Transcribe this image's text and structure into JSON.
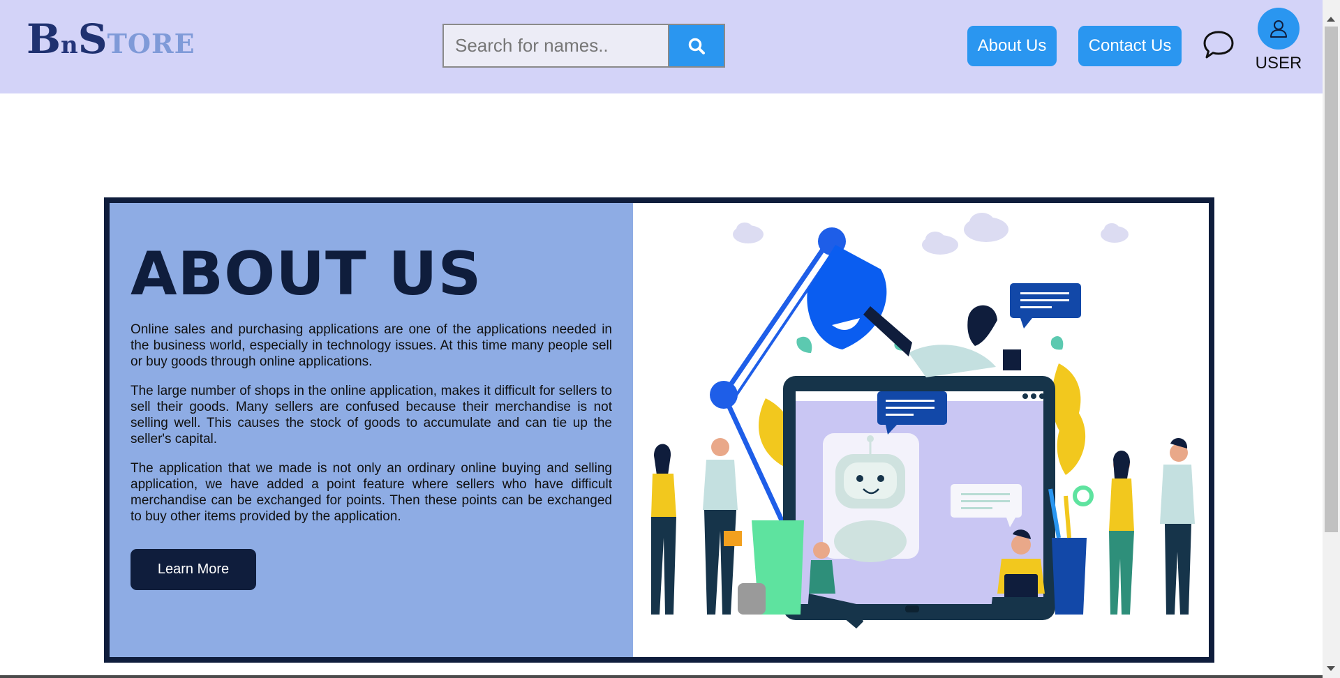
{
  "header": {
    "logo": {
      "b": "B",
      "n": "n",
      "s": "S",
      "rest": "TORE"
    },
    "search": {
      "placeholder": "Search for names..",
      "icon": "search-icon"
    },
    "nav": {
      "about_label": "About Us",
      "contact_label": "Contact Us"
    },
    "chat_icon": "chat-bubble-icon",
    "user": {
      "icon": "user-icon",
      "label": "USER"
    }
  },
  "about": {
    "title": "ABOUT US",
    "paragraphs": [
      "Online sales and purchasing applications are one of the applications needed in the business world, especially in technology issues. At this time many people sell or buy goods through online applications.",
      "The large number of shops in the online application, makes it difficult for sellers to sell their goods. Many sellers are confused because their merchandise is not selling well. This causes the stock of goods to accumulate and can tie up the seller's capital.",
      "The application that we made is not only an ordinary online buying and selling application, we have added a point feature where sellers who have difficult merchandise can be exchanged for points. Then these points can be exchanged to buy other items provided by the application."
    ],
    "learn_more_label": "Learn More"
  },
  "colors": {
    "header_bg": "#d3d3f8",
    "accent": "#2a96f0",
    "navy": "#0f1d3c",
    "panel_left": "#8eace4"
  }
}
